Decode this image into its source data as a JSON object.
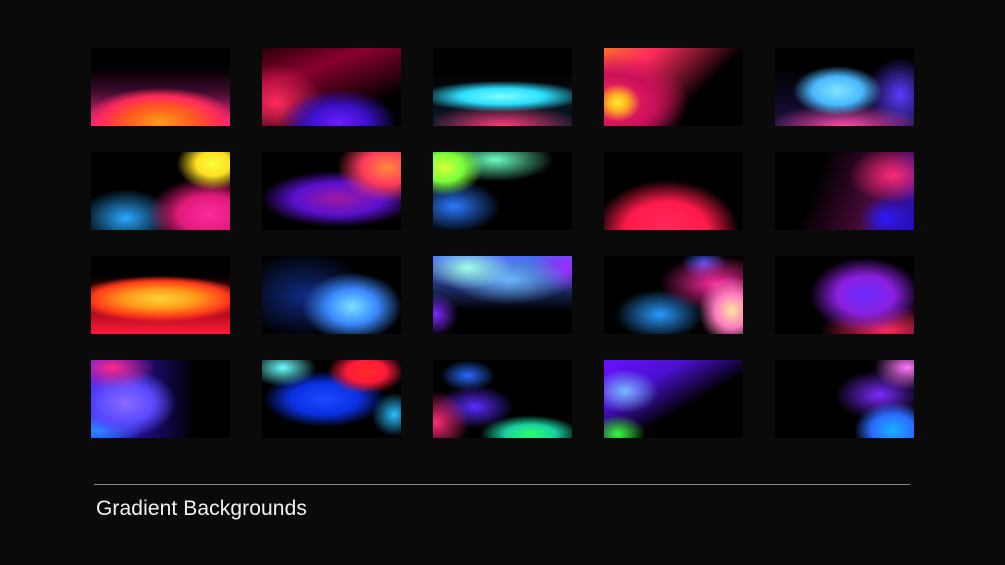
{
  "caption": "Gradient Backgrounds",
  "colors": {
    "background": "#0a0a0a",
    "caption_text": "#f2f2f2",
    "divider": "#8a8a8a"
  },
  "swatches": [
    {
      "dominant": "#ff5a1f"
    },
    {
      "dominant": "#6b1bff"
    },
    {
      "dominant": "#2ce0ff"
    },
    {
      "dominant": "#ff2a5c"
    },
    {
      "dominant": "#4ab8ff"
    },
    {
      "dominant": "#ff2aa0"
    },
    {
      "dominant": "#ff3a5c"
    },
    {
      "dominant": "#7aff3a"
    },
    {
      "dominant": "#ff1a4a"
    },
    {
      "dominant": "#2010c8"
    },
    {
      "dominant": "#ff9a1a"
    },
    {
      "dominant": "#3a8aff"
    },
    {
      "dominant": "#6ab8ff"
    },
    {
      "dominant": "#ff7ac0"
    },
    {
      "dominant": "#6a2aff"
    },
    {
      "dominant": "#5a4aff"
    },
    {
      "dominant": "#1a4aff"
    },
    {
      "dominant": "#2aff6a"
    },
    {
      "dominant": "#6a10ff"
    },
    {
      "dominant": "#1ab0ff"
    }
  ]
}
